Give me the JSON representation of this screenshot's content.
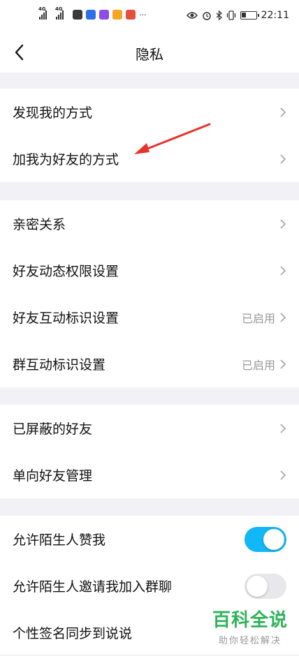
{
  "status_bar": {
    "net1": "4G",
    "net2": "4G",
    "more": "···",
    "time": "22:11",
    "icons": [
      "signal-icon",
      "signal-icon",
      "app-icon",
      "app-icon",
      "app-icon",
      "app-icon",
      "app-icon",
      "eye-icon",
      "alarm-icon",
      "bluetooth-icon",
      "vibrate-icon",
      "battery-icon"
    ]
  },
  "header": {
    "title": "隐私",
    "back_icon": "chevron-left-icon"
  },
  "groups": [
    {
      "items": [
        {
          "label": "发现我的方式",
          "control": "chevron"
        },
        {
          "label": "加我为好友的方式",
          "control": "chevron"
        }
      ]
    },
    {
      "items": [
        {
          "label": "亲密关系",
          "control": "chevron"
        },
        {
          "label": "好友动态权限设置",
          "control": "chevron"
        },
        {
          "label": "好友互动标识设置",
          "value": "已启用",
          "control": "chevron"
        },
        {
          "label": "群互动标识设置",
          "value": "已启用",
          "control": "chevron"
        }
      ]
    },
    {
      "items": [
        {
          "label": "已屏蔽的好友",
          "control": "chevron"
        },
        {
          "label": "单向好友管理",
          "control": "chevron"
        }
      ]
    },
    {
      "items": [
        {
          "label": "允许陌生人赞我",
          "control": "toggle",
          "on": true
        },
        {
          "label": "允许陌生人邀请我加入群聊",
          "control": "toggle",
          "on": false
        },
        {
          "label": "个性签名同步到说说",
          "control": "none"
        }
      ]
    }
  ],
  "annotation": {
    "color": "#e8332a"
  },
  "watermark": {
    "main": "百科全说",
    "sub": "助你轻松解决",
    "color": "#2fb25a"
  },
  "colors": {
    "toggle_on": "#12b7f5",
    "toggle_off": "#e8e8ec",
    "background": "#f2f2f6"
  }
}
